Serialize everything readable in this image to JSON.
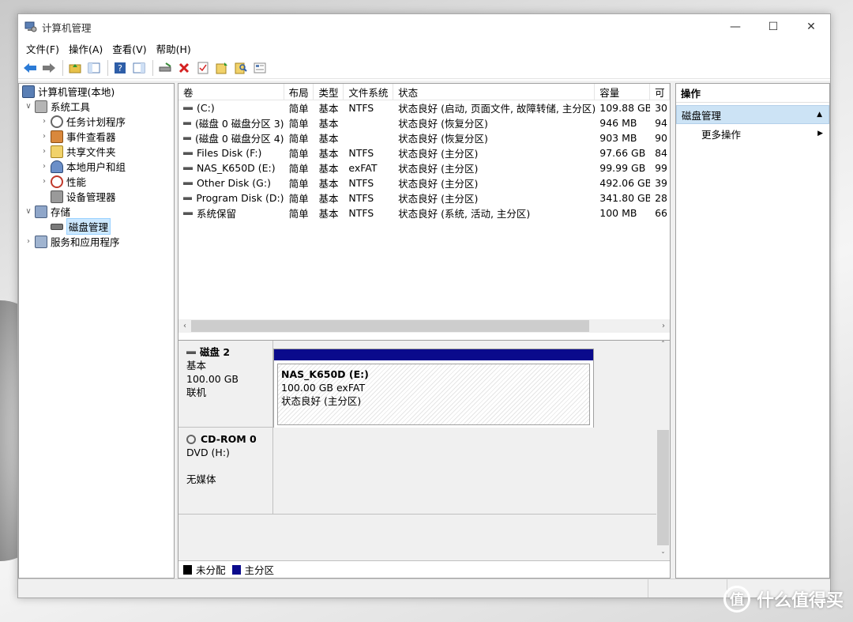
{
  "window": {
    "title": "计算机管理"
  },
  "menu": [
    "文件(F)",
    "操作(A)",
    "查看(V)",
    "帮助(H)"
  ],
  "tree": {
    "root": "计算机管理(本地)",
    "system_tools": "系统工具",
    "task_scheduler": "任务计划程序",
    "event_viewer": "事件查看器",
    "shared_folders": "共享文件夹",
    "local_users": "本地用户和组",
    "performance": "性能",
    "device_manager": "设备管理器",
    "storage": "存储",
    "disk_management": "磁盘管理",
    "services": "服务和应用程序"
  },
  "table": {
    "headers": [
      "卷",
      "布局",
      "类型",
      "文件系统",
      "状态",
      "容量",
      "可"
    ],
    "rows": [
      [
        "(C:)",
        "简单",
        "基本",
        "NTFS",
        "状态良好 (启动, 页面文件, 故障转储, 主分区)",
        "109.88 GB",
        "30"
      ],
      [
        "(磁盘 0 磁盘分区 3)",
        "简单",
        "基本",
        "",
        "状态良好 (恢复分区)",
        "946 MB",
        "94"
      ],
      [
        "(磁盘 0 磁盘分区 4)",
        "简单",
        "基本",
        "",
        "状态良好 (恢复分区)",
        "903 MB",
        "90"
      ],
      [
        "Files Disk (F:)",
        "简单",
        "基本",
        "NTFS",
        "状态良好 (主分区)",
        "97.66 GB",
        "84"
      ],
      [
        "NAS_K650D (E:)",
        "简单",
        "基本",
        "exFAT",
        "状态良好 (主分区)",
        "99.99 GB",
        "99"
      ],
      [
        "Other Disk (G:)",
        "简单",
        "基本",
        "NTFS",
        "状态良好 (主分区)",
        "492.06 GB",
        "39"
      ],
      [
        "Program Disk (D:)",
        "简单",
        "基本",
        "NTFS",
        "状态良好 (主分区)",
        "341.80 GB",
        "28"
      ],
      [
        "系统保留",
        "简单",
        "基本",
        "NTFS",
        "状态良好 (系统, 活动, 主分区)",
        "100 MB",
        "66"
      ]
    ]
  },
  "disk2": {
    "name": "磁盘 2",
    "type": "基本",
    "size": "100.00 GB",
    "status": "联机",
    "partition": {
      "name": "NAS_K650D  (E:)",
      "size": "100.00 GB exFAT",
      "status": "状态良好 (主分区)"
    }
  },
  "cdrom": {
    "name": "CD-ROM 0",
    "drive": "DVD (H:)",
    "media": "无媒体"
  },
  "legend": {
    "unallocated": "未分配",
    "primary": "主分区"
  },
  "actions": {
    "header": "操作",
    "section": "磁盘管理",
    "more": "更多操作"
  },
  "watermark": {
    "text": "什么值得买",
    "glyph": "值"
  },
  "colors": {
    "primary_partition": "#0a0a8c",
    "selection": "#cce8ff",
    "action_section": "#cce3f5"
  }
}
